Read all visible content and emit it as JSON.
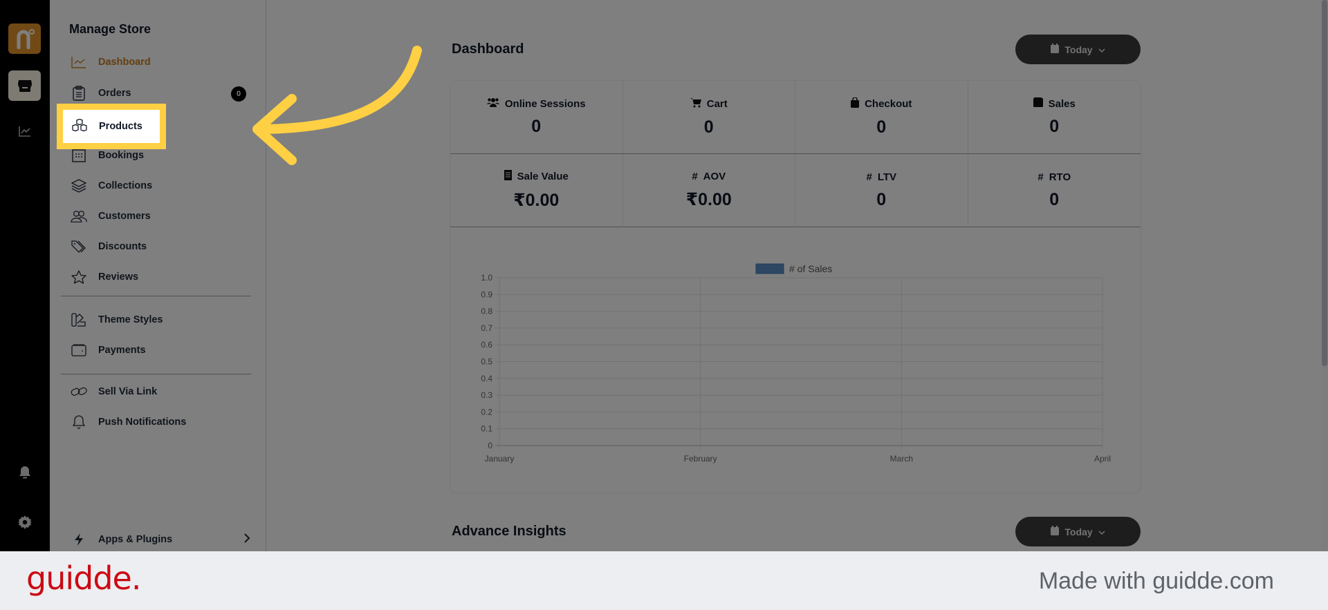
{
  "rail": {
    "icons": [
      "brand-logo-icon",
      "store-icon",
      "analytics-icon",
      "bell-icon",
      "gear-icon"
    ],
    "logo_letter": "n",
    "brand_color": "#e3922b"
  },
  "sidebar": {
    "title": "Manage Store",
    "items": [
      {
        "label": "Dashboard",
        "icon": "chart-line-icon",
        "active": true
      },
      {
        "label": "Orders",
        "icon": "clipboard-icon",
        "badge": "0"
      },
      {
        "label": "Products",
        "icon": "boxes-icon",
        "highlighted": true
      },
      {
        "label": "Bookings",
        "icon": "calendar-grid-icon"
      },
      {
        "label": "Collections",
        "icon": "layers-icon"
      },
      {
        "label": "Customers",
        "icon": "users-icon"
      },
      {
        "label": "Discounts",
        "icon": "tags-icon"
      },
      {
        "label": "Reviews",
        "icon": "star-icon"
      },
      {
        "label": "Theme Styles",
        "icon": "swatch-icon"
      },
      {
        "label": "Payments",
        "icon": "wallet-icon"
      },
      {
        "label": "Sell Via Link",
        "icon": "link-icon"
      },
      {
        "label": "Push Notifications",
        "icon": "bell-icon"
      }
    ],
    "apps_plugins": {
      "label": "Apps & Plugins",
      "icon": "bolt-icon"
    },
    "accent_color": "#c47f22"
  },
  "dashboard": {
    "title": "Dashboard",
    "date_filter": "Today",
    "stats": [
      {
        "label": "Online Sessions",
        "icon": "users-icon",
        "value": "0"
      },
      {
        "label": "Cart",
        "icon": "cart-icon",
        "value": "0"
      },
      {
        "label": "Checkout",
        "icon": "bag-icon",
        "value": "0"
      },
      {
        "label": "Sales",
        "icon": "wallet-icon",
        "value": "0"
      },
      {
        "label": "Sale Value",
        "icon": "receipt-icon",
        "value": "₹0.00"
      },
      {
        "label": "AOV",
        "icon": "hash-icon",
        "value": "₹0.00"
      },
      {
        "label": "LTV",
        "icon": "hash-icon",
        "value": "0"
      },
      {
        "label": "RTO",
        "icon": "hash-icon",
        "value": "0"
      }
    ]
  },
  "advance_insights": {
    "title": "Advance Insights",
    "date_filter": "Today"
  },
  "chart_data": {
    "type": "bar",
    "categories": [
      "January",
      "February",
      "March",
      "April"
    ],
    "series": [
      {
        "name": "# of Sales",
        "values": [
          0,
          0,
          0,
          0
        ],
        "color": "#5b8fc7"
      }
    ],
    "yticks": [
      "0",
      "0.1",
      "0.2",
      "0.3",
      "0.4",
      "0.5",
      "0.6",
      "0.7",
      "0.8",
      "0.9",
      "1.0"
    ],
    "ylim": [
      0,
      1
    ],
    "title": "",
    "xlabel": "",
    "ylabel": "",
    "grid": true,
    "legend": "top-center"
  },
  "annotation": {
    "highlight_color": "#ffd043",
    "highlight_target": "Products"
  },
  "footer": {
    "logo": "guidde.",
    "tagline": "Made with guidde.com",
    "logo_color": "#cc0a14"
  }
}
